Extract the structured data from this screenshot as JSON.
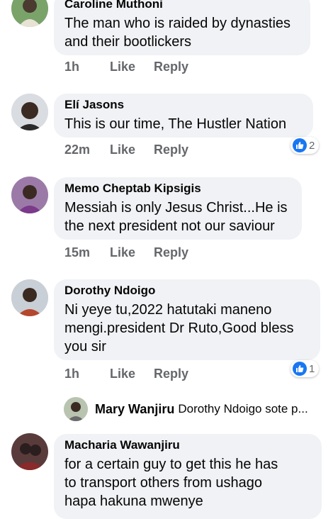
{
  "comments": [
    {
      "name": "Caroline Muthoni",
      "lines": [
        "The man who is raided by dynasties",
        "and their bootlickers"
      ],
      "time": "1h",
      "like": "Like",
      "reply": "Reply"
    },
    {
      "name": "Elí Jasons",
      "lines": [
        "This is our time, The Hustler Nation"
      ],
      "time": "22m",
      "like": "Like",
      "reply": "Reply",
      "reactions": "2"
    },
    {
      "name": "Memo Cheptab Kipsigis",
      "lines": [
        "Messiah is only Jesus Christ...He is",
        "the next president not our saviour"
      ],
      "time": "15m",
      "like": "Like",
      "reply": "Reply"
    },
    {
      "name": "Dorothy Ndoigo",
      "lines": [
        "Ni yeye tu,2022 hatutaki maneno",
        "mengi.president Dr Ruto,Good bless",
        "you sir"
      ],
      "time": "1h",
      "like": "Like",
      "reply": "Reply",
      "reactions": "1"
    },
    {
      "name": "Macharia Wawanjiru",
      "lines": [
        "for a certain guy to get this he has",
        "to transport others from ushago",
        "hapa hakuna mwenye"
      ]
    }
  ],
  "reply_preview": {
    "name": "Mary Wanjiru",
    "text": "Dorothy Ndoigo sote p..."
  },
  "colors": {
    "bubble": "#f0f2f5",
    "meta": "#65676b",
    "like_badge": "#1877f2"
  }
}
